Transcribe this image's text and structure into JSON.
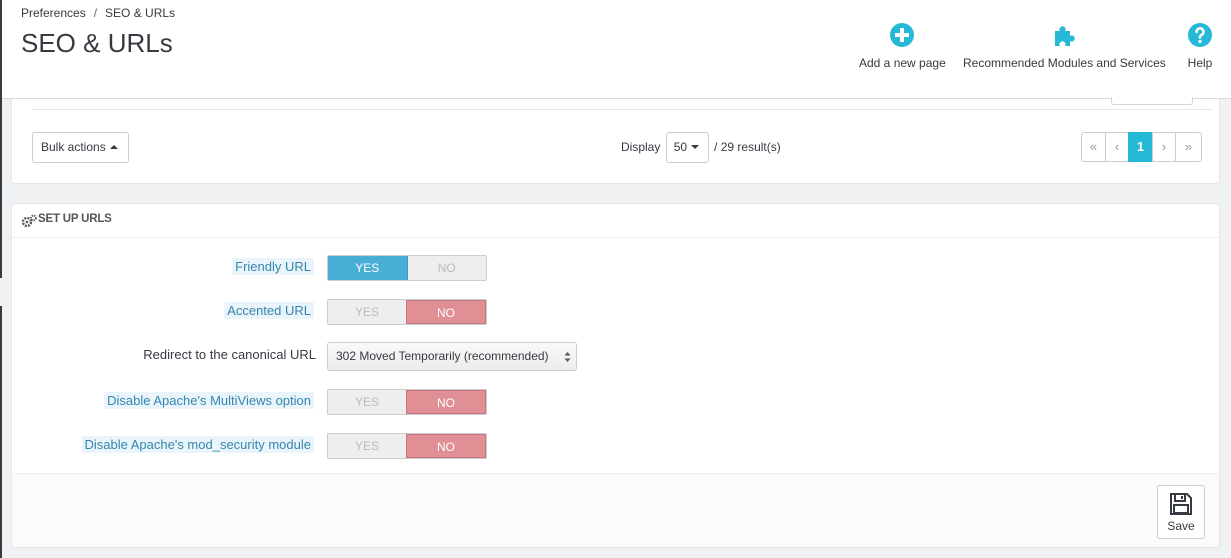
{
  "header": {
    "breadcrumb": [
      "Preferences",
      "SEO & URLs"
    ],
    "breadcrumb_separator": "/",
    "title": "SEO & URLs",
    "toolbar": [
      {
        "label": "Add a new page",
        "icon": "plus-circle-icon"
      },
      {
        "label": "Recommended Modules and Services",
        "icon": "puzzle-icon"
      },
      {
        "label": "Help",
        "icon": "question-circle-icon"
      }
    ]
  },
  "list_controls": {
    "bulk_actions_label": "Bulk actions",
    "display_label": "Display",
    "display_value": "50",
    "results_text": "/ 29 result(s)",
    "pagination": {
      "first": "«",
      "prev": "‹",
      "current": "1",
      "next": "›",
      "last": "»"
    }
  },
  "setup_urls": {
    "title": "SET UP URLS",
    "fields": [
      {
        "label": "Friendly URL",
        "yes": "YES",
        "no": "NO",
        "value": "YES"
      },
      {
        "label": "Accented URL",
        "yes": "YES",
        "no": "NO",
        "value": "NO"
      },
      {
        "label": "Redirect to the canonical URL",
        "select_value": "302 Moved Temporarily (recommended)"
      },
      {
        "label": "Disable Apache's MultiViews option",
        "yes": "YES",
        "no": "NO",
        "value": "NO"
      },
      {
        "label": "Disable Apache's mod_security module",
        "yes": "YES",
        "no": "NO",
        "value": "NO"
      }
    ],
    "save_label": "Save"
  },
  "colors": {
    "accent": "#25b9d7",
    "yes_active": "#49aed4",
    "no_active": "#e08f95"
  }
}
